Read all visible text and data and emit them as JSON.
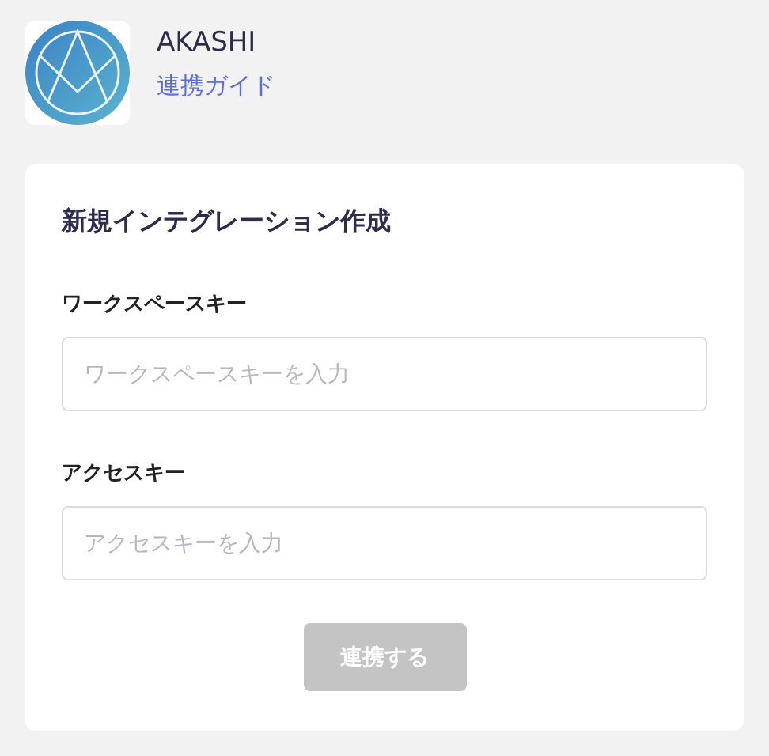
{
  "app": {
    "name": "AKASHI",
    "guide_link": "連携ガイド"
  },
  "form": {
    "title": "新規インテグレーション作成",
    "fields": [
      {
        "label": "ワークスペースキー",
        "placeholder": "ワークスペースキーを入力"
      },
      {
        "label": "アクセスキー",
        "placeholder": "アクセスキーを入力"
      }
    ],
    "submit": {
      "label": "連携する",
      "disabled": true
    }
  }
}
